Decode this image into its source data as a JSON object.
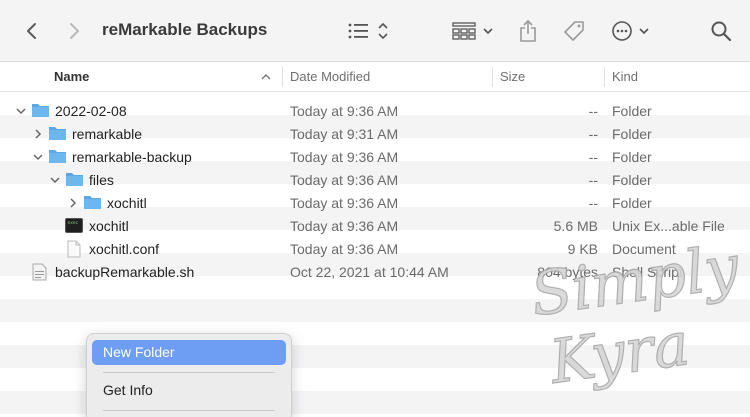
{
  "window": {
    "title": "reMarkable Backups"
  },
  "toolbar": {
    "back_icon": "chevron-left-icon",
    "forward_icon": "chevron-right-icon",
    "view_icon": "list-view-icon",
    "group_icon": "group-grid-icon",
    "share_icon": "share-icon",
    "tag_icon": "tag-icon",
    "more_icon": "ellipsis-circle-icon",
    "search_icon": "search-icon"
  },
  "columns": {
    "name": "Name",
    "modified": "Date Modified",
    "size": "Size",
    "kind": "Kind"
  },
  "files": [
    {
      "name": "2022-02-08",
      "modified": "Today at 9:36 AM",
      "size": "--",
      "kind": "Folder",
      "icon": "folder-icon",
      "depth": 0,
      "expanded": true
    },
    {
      "name": "remarkable",
      "modified": "Today at 9:31 AM",
      "size": "--",
      "kind": "Folder",
      "icon": "folder-icon",
      "depth": 1,
      "expanded": false
    },
    {
      "name": "remarkable-backup",
      "modified": "Today at 9:36 AM",
      "size": "--",
      "kind": "Folder",
      "icon": "folder-icon",
      "depth": 1,
      "expanded": true
    },
    {
      "name": "files",
      "modified": "Today at 9:36 AM",
      "size": "--",
      "kind": "Folder",
      "icon": "folder-icon",
      "depth": 2,
      "expanded": true
    },
    {
      "name": "xochitl",
      "modified": "Today at 9:36 AM",
      "size": "--",
      "kind": "Folder",
      "icon": "folder-icon",
      "depth": 3,
      "expanded": false
    },
    {
      "name": "xochitl",
      "modified": "Today at 9:36 AM",
      "size": "5.6 MB",
      "kind": "Unix Ex...able File",
      "icon": "terminal-exec-icon",
      "depth": 2,
      "expanded": null
    },
    {
      "name": "xochitl.conf",
      "modified": "Today at 9:36 AM",
      "size": "9 KB",
      "kind": "Document",
      "icon": "document-icon",
      "depth": 2,
      "expanded": null
    },
    {
      "name": "backupRemarkable.sh",
      "modified": "Oct 22, 2021 at 10:44 AM",
      "size": "804 bytes",
      "kind": "Shell Script",
      "icon": "script-icon",
      "depth": 0,
      "expanded": null
    }
  ],
  "context_menu": {
    "items": [
      "New Folder",
      "Get Info"
    ],
    "selected": "New Folder"
  },
  "watermark": {
    "line1": "Simply",
    "line2": "Kyra"
  },
  "colors": {
    "folder": "#5aa9e6",
    "selection": "#6e9ef3",
    "accent": "#3478f6"
  }
}
